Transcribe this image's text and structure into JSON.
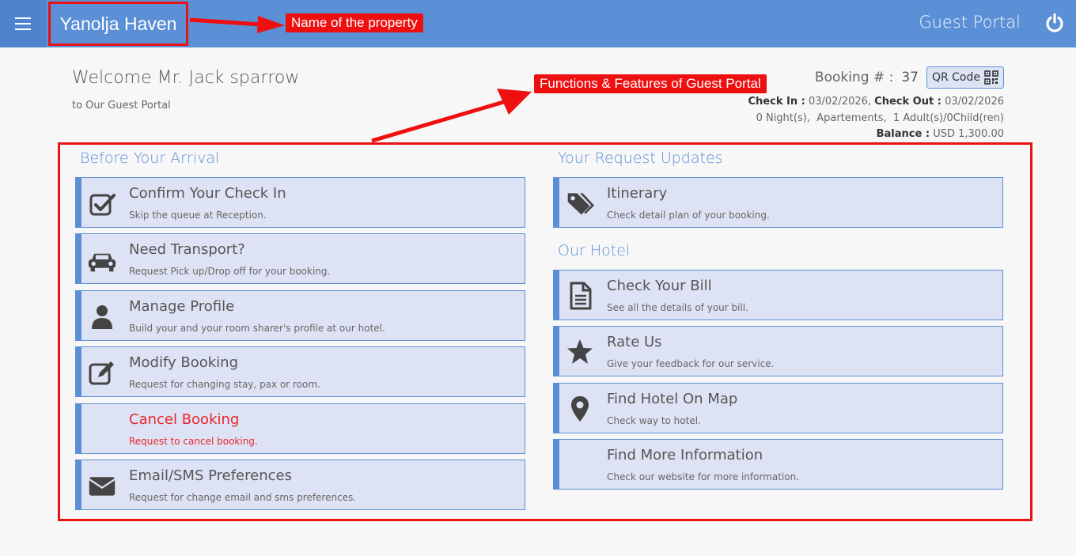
{
  "header": {
    "property_name": "Yanolja Haven",
    "portal_title": "Guest Portal"
  },
  "annotations": {
    "property": "Name of the property",
    "functions": "Functions & Features of Guest Portal"
  },
  "welcome": {
    "greeting": "Welcome Mr. Jack sparrow",
    "sub": "to Our Guest Portal"
  },
  "booking": {
    "label": "Booking # :",
    "number": "37",
    "qr_label": "QR Code",
    "checkin_label": "Check In :",
    "checkin_date": "03/02/2026,",
    "checkout_label": "Check Out :",
    "checkout_date": "03/02/2026",
    "stay_summary": "0 Night(s),  Apartements,  1 Adult(s)/0Child(ren)",
    "balance_label": "Balance :",
    "balance_value": "USD 1,300.00"
  },
  "sections": {
    "before_arrival": "Before Your Arrival",
    "request_updates": "Your Request Updates",
    "our_hotel": "Our Hotel"
  },
  "left_cards": [
    {
      "title": "Confirm Your Check In",
      "desc": "Skip the queue at Reception.",
      "icon": "checkbox-icon"
    },
    {
      "title": "Need Transport?",
      "desc": "Request Pick up/Drop off for your booking.",
      "icon": "car-icon"
    },
    {
      "title": "Manage Profile",
      "desc": "Build your and your room sharer's profile at our hotel.",
      "icon": "user-icon"
    },
    {
      "title": "Modify Booking",
      "desc": "Request for changing stay, pax or room.",
      "icon": "edit-icon"
    },
    {
      "title": "Cancel Booking",
      "desc": "Request to cancel booking.",
      "icon": ""
    },
    {
      "title": "Email/SMS Preferences",
      "desc": "Request for change email and sms preferences.",
      "icon": "envelope-icon"
    }
  ],
  "right_cards": [
    {
      "title": "Itinerary",
      "desc": "Check detail plan of your booking.",
      "icon": "tags-icon"
    },
    {
      "title": "Check Your Bill",
      "desc": "See all the details of your bill.",
      "icon": "document-icon"
    },
    {
      "title": "Rate Us",
      "desc": "Give your feedback for our service.",
      "icon": "star-icon"
    },
    {
      "title": "Find Hotel On Map",
      "desc": "Check way to hotel.",
      "icon": "map-pin-icon"
    },
    {
      "title": "Find More Information",
      "desc": "Check our website for more information.",
      "icon": ""
    }
  ],
  "colors": {
    "header": "#5b8fd6",
    "card_bg": "#dde3f4",
    "annotation": "#e81313",
    "cancel_text": "#e8262a"
  }
}
